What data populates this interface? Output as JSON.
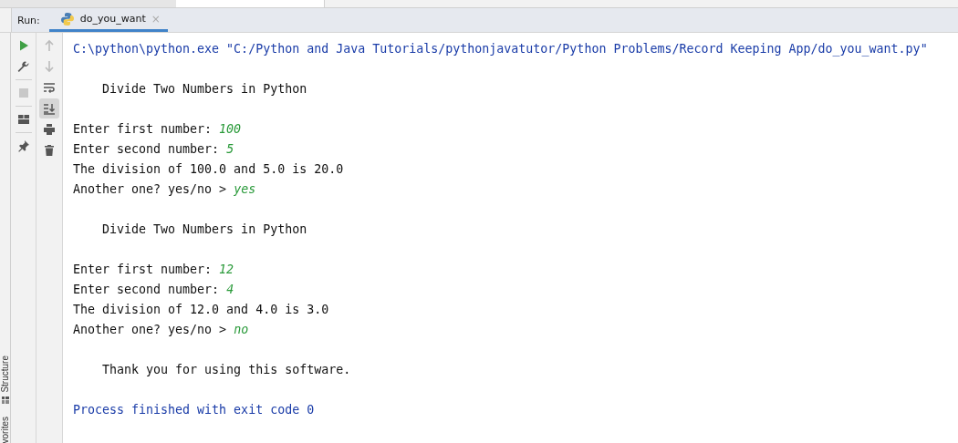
{
  "run_panel": {
    "label": "Run:",
    "tab": {
      "title": "do_you_want",
      "selected": true,
      "close": "×"
    }
  },
  "toolbar": [
    {
      "kind": "run",
      "active": true
    },
    {
      "kind": "wrench",
      "active": true
    },
    {
      "kind": "stop",
      "active": false
    },
    {
      "kind": "layout",
      "active": true
    },
    {
      "kind": "pin",
      "active": true
    }
  ],
  "toolbar_2": [
    {
      "kind": "up",
      "active": false,
      "selected": false
    },
    {
      "kind": "down",
      "active": false,
      "selected": false
    },
    {
      "kind": "wrap",
      "active": true,
      "selected": false
    },
    {
      "kind": "scrollend",
      "active": true,
      "selected": true
    },
    {
      "kind": "print",
      "active": true,
      "selected": false
    },
    {
      "kind": "trash",
      "active": true,
      "selected": false
    }
  ],
  "side_tabs": [
    {
      "label": "Structure",
      "icon": true
    },
    {
      "label": "vorites",
      "icon": false
    }
  ],
  "console": [
    {
      "kind": "path",
      "text": "C:\\python\\python.exe \"C:/Python and Java Tutorials/pythonjavatutor/Python Problems/Record Keeping App/do_you_want.py\""
    },
    {
      "kind": "blank"
    },
    {
      "kind": "output",
      "text": "    Divide Two Numbers in Python"
    },
    {
      "kind": "blank"
    },
    {
      "kind": "prompt",
      "text": "Enter first number: ",
      "input": "100"
    },
    {
      "kind": "prompt",
      "text": "Enter second number: ",
      "input": "5"
    },
    {
      "kind": "output",
      "text": "The division of 100.0 and 5.0 is 20.0"
    },
    {
      "kind": "prompt",
      "text": "Another one? yes/no > ",
      "input": "yes"
    },
    {
      "kind": "blank"
    },
    {
      "kind": "output",
      "text": "    Divide Two Numbers in Python"
    },
    {
      "kind": "blank"
    },
    {
      "kind": "prompt",
      "text": "Enter first number: ",
      "input": "12"
    },
    {
      "kind": "prompt",
      "text": "Enter second number: ",
      "input": "4"
    },
    {
      "kind": "output",
      "text": "The division of 12.0 and 4.0 is 3.0"
    },
    {
      "kind": "prompt",
      "text": "Another one? yes/no > ",
      "input": "no"
    },
    {
      "kind": "blank"
    },
    {
      "kind": "output",
      "text": "    Thank you for using this software."
    },
    {
      "kind": "blank"
    },
    {
      "kind": "path",
      "text": "Process finished with exit code 0"
    }
  ]
}
